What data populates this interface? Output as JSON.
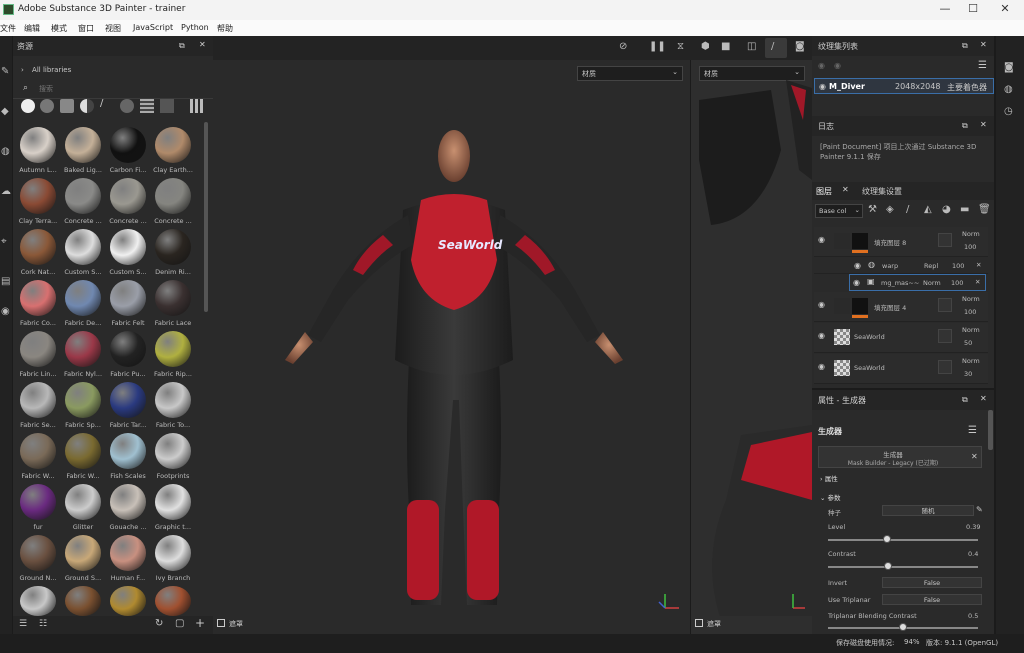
{
  "window": {
    "title": "Adobe Substance 3D Painter - trainer",
    "minimize": "—",
    "maximize": "☐",
    "close": "✕"
  },
  "menu": [
    "文件",
    "编辑",
    "模式",
    "窗口",
    "视图",
    "JavaScript",
    "Python",
    "帮助"
  ],
  "assets": {
    "title": "资源",
    "breadcrumb": "All libraries",
    "search_placeholder": "搜索",
    "items": [
      "Autumn L...",
      "Baked Lig...",
      "Carbon Fi...",
      "Clay Earth...",
      "Clay Terra...",
      "Concrete ...",
      "Concrete ...",
      "Concrete ...",
      "Cork Nat...",
      "Custom S...",
      "Custom S...",
      "Denim Ri...",
      "Fabric Co...",
      "Fabric De...",
      "Fabric Felt",
      "Fabric Lace",
      "Fabric Lin...",
      "Fabric Nyl...",
      "Fabric Pu...",
      "Fabric Rip...",
      "Fabric Se...",
      "Fabric Sp...",
      "Fabric Tar...",
      "Fabric To...",
      "Fabric W...",
      "Fabric W...",
      "Fish Scales",
      "Footprints",
      "fur",
      "Glitter",
      "Gouache ...",
      "Graphic t...",
      "Ground N...",
      "Ground S...",
      "Human F...",
      "Ivy Branch",
      "",
      "",
      "",
      ""
    ],
    "colors": [
      "#d8d0c8",
      "#c4b098",
      "#111111",
      "#b08a6a",
      "#8a4a34",
      "#8a8a88",
      "#9a9890",
      "#858580",
      "#8a5838",
      "#dddddd",
      "#f0f0f0",
      "#2a2520",
      "#d87070",
      "#7088b0",
      "#9a9ea8",
      "#3a3030",
      "#8a8680",
      "#9a3848",
      "#222222",
      "#b0b040",
      "#b8b8b8",
      "#8a9a60",
      "#2a3a80",
      "#c8c8c8",
      "#7a6a58",
      "#7a6a30",
      "#a0c0d0",
      "#cccccc",
      "#6a2a80",
      "#cccccc",
      "#c8c0b8",
      "#e0e0e0",
      "#6a5040",
      "#c8a878",
      "#c89080",
      "#dddddd",
      "#c8c8c8",
      "#7a5030",
      "#b08a30",
      "#a05030"
    ]
  },
  "viewport": {
    "material_left": "材质",
    "material_right": "材质",
    "mask_left": "遮罩",
    "mask_right": "遮罩",
    "logo_text": "SeaWorld"
  },
  "texture_sets": {
    "title": "纹理集列表",
    "name": "M_Diver",
    "size": "2048x2048",
    "shader": "主要着色器"
  },
  "log": {
    "title": "日志",
    "text": "[Paint Document] 项目上次通过 Substance 3D Painter 9.1.1 保存"
  },
  "layers": {
    "tab1": "图层",
    "tab2": "纹理集设置",
    "channel": "Base col",
    "rows": [
      {
        "name": "填充图层 8",
        "blend": "Norm",
        "opacity": "100"
      },
      {
        "name": "warp",
        "blend": "Repl",
        "opacity": "100"
      },
      {
        "name": "mg_mas~~",
        "blend": "Norm",
        "opacity": "100"
      },
      {
        "name": "填充图层 4",
        "blend": "Norm",
        "opacity": "100"
      },
      {
        "name": "SeaWorld",
        "blend": "Norm",
        "opacity": "50"
      },
      {
        "name": "SeaWorld",
        "blend": "Norm",
        "opacity": "30"
      }
    ]
  },
  "properties": {
    "title": "属性 - 生成器",
    "section": "生成器",
    "gen_name": "生成器",
    "gen_sub": "Mask Builder - Legacy (已过期)",
    "attr": "属性",
    "params": "参数",
    "seed_label": "种子",
    "seed_value": "随机",
    "level_label": "Level",
    "level_value": "0.39",
    "level": 0.39,
    "contrast_label": "Contrast",
    "contrast_value": "0.4",
    "contrast": 0.4,
    "invert_label": "Invert",
    "invert_value": "False",
    "tri_label": "Use Triplanar",
    "tri_value": "False",
    "blend_label": "Triplanar Blending Contrast",
    "blend_value": "0.5",
    "blend": 0.5
  },
  "status": {
    "text": "保存磁盘使用情况:",
    "pct": "94%",
    "version": "版本: 9.1.1 (OpenGL)"
  }
}
